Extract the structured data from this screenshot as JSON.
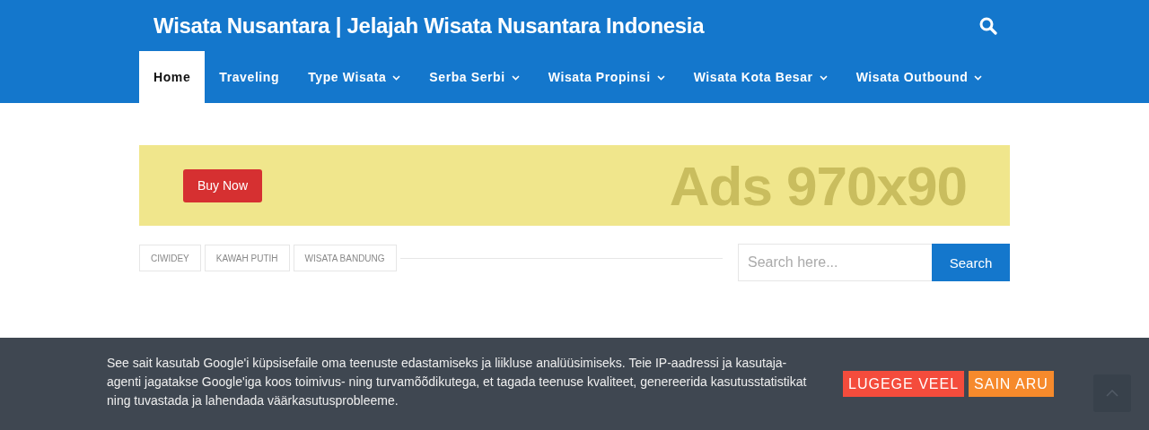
{
  "site_title": "Wisata Nusantara | Jelajah Wisata Nusantara Indonesia",
  "nav": [
    {
      "label": "Home",
      "selected": true,
      "dropdown": false
    },
    {
      "label": "Traveling",
      "selected": false,
      "dropdown": false
    },
    {
      "label": "Type Wisata",
      "selected": false,
      "dropdown": true
    },
    {
      "label": "Serba Serbi",
      "selected": false,
      "dropdown": true
    },
    {
      "label": "Wisata Propinsi",
      "selected": false,
      "dropdown": true
    },
    {
      "label": "Wisata Kota Besar",
      "selected": false,
      "dropdown": true
    },
    {
      "label": "Wisata Outbound",
      "selected": false,
      "dropdown": true
    }
  ],
  "ad": {
    "button": "Buy Now",
    "text": "Ads 970x90"
  },
  "tags": [
    "CIWIDEY",
    "KAWAH PUTIH",
    "WISATA BANDUNG"
  ],
  "sidebar": {
    "search": {
      "placeholder": "Search here...",
      "button": "Search"
    }
  },
  "cookie": {
    "text": "See sait kasutab Google'i küpsisefaile oma teenuste edastamiseks ja liikluse analüüsimiseks. Teie IP-aadressi ja kasutaja-agenti jagatakse Google'iga koos toimivus- ning turvamõõdikutega, et tagada teenuse kvaliteet, genereerida kasutusstatistikat ning tuvastada ja lahendada väärkasutusprobleeme.",
    "more": "LUGEGE VEEL",
    "ok": "SAIN ARU"
  }
}
